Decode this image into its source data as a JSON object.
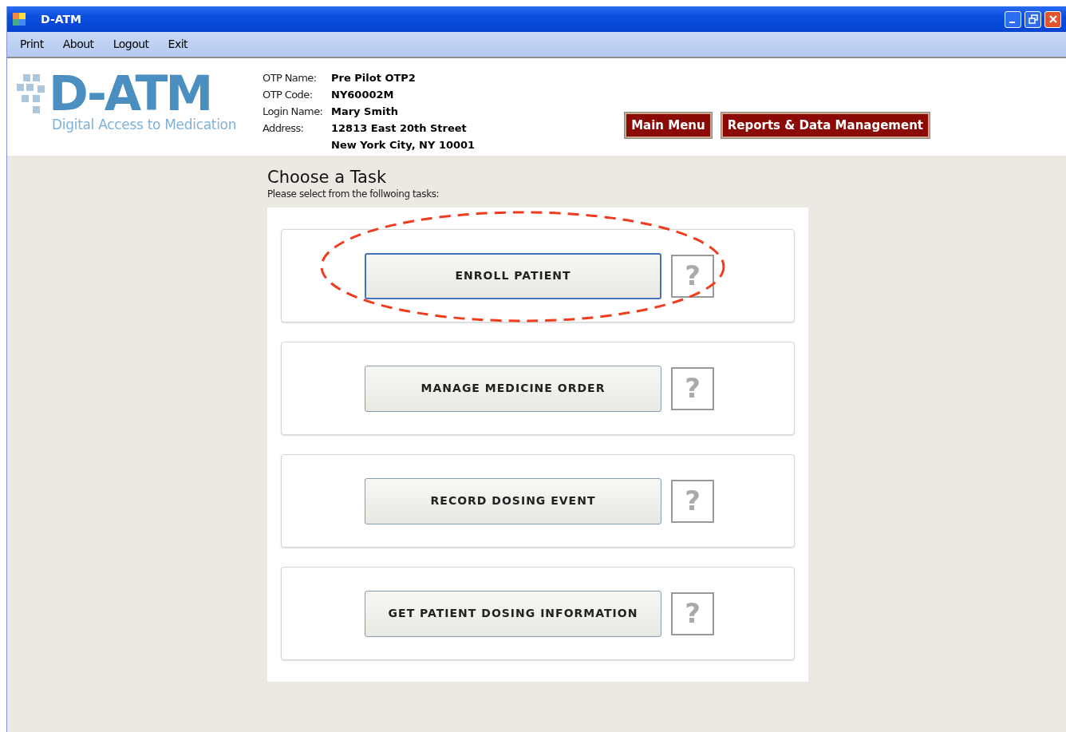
{
  "window": {
    "title": "D-ATM"
  },
  "menu": [
    "Print",
    "About",
    "Logout",
    "Exit"
  ],
  "logo": {
    "name": "D-ATM",
    "tagline": "Digital Access to Medication"
  },
  "info": [
    {
      "label": "OTP Name:",
      "value": "Pre Pilot OTP2"
    },
    {
      "label": "OTP Code:",
      "value": "NY60002M"
    },
    {
      "label": "Login Name:",
      "value": "Mary Smith"
    },
    {
      "label": "Address:",
      "value": "12813 East 20th Street",
      "value_2": "New York City, NY 10001"
    }
  ],
  "nav_buttons": [
    "Main Menu",
    "Reports & Data Management"
  ],
  "heading": "Choose a Task",
  "subheading": "Please select from the follwoing tasks:",
  "tasks": [
    {
      "label": "ENROLL PATIENT",
      "help": "?",
      "focused": true,
      "circled": true
    },
    {
      "label": "MANAGE MEDICINE ORDER",
      "help": "?",
      "focused": false,
      "circled": false
    },
    {
      "label": "RECORD DOSING EVENT",
      "help": "?",
      "focused": false,
      "circled": false
    },
    {
      "label": "GET PATIENT DOSING INFORMATION",
      "help": "?",
      "focused": false,
      "circled": false
    }
  ]
}
